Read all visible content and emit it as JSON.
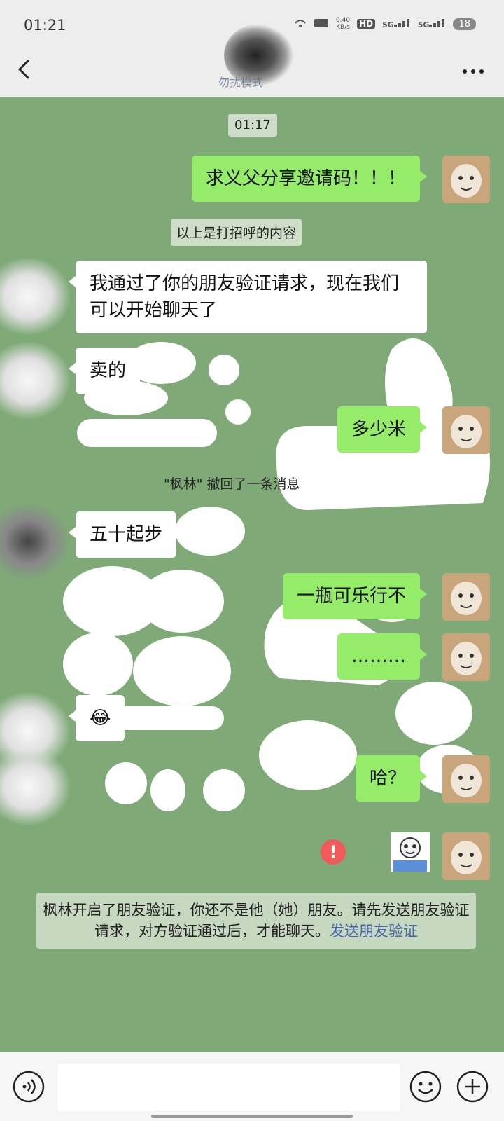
{
  "status_bar": {
    "time": "01:21",
    "net_speed": "0.40\nKB/s",
    "hd": "HD",
    "signal1": "5G",
    "signal2": "5G",
    "battery": "18"
  },
  "header": {
    "title": "勿扰模式",
    "icons": [
      "back-chevron-icon",
      "more-dots-icon"
    ]
  },
  "chat": {
    "timestamp": "01:17",
    "messages": [
      {
        "side": "me",
        "text": "求义父分享邀请码！！！"
      },
      {
        "side": "system",
        "text": "以上是打招呼的内容"
      },
      {
        "side": "them",
        "text": "我通过了你的朋友验证请求，现在我们可以开始聊天了"
      },
      {
        "side": "them",
        "text": "卖的"
      },
      {
        "side": "me",
        "text": "多少米"
      },
      {
        "side": "system",
        "text": "\"枫林\" 撤回了一条消息"
      },
      {
        "side": "them",
        "text": "五十起步"
      },
      {
        "side": "me",
        "text": "一瓶可乐行不"
      },
      {
        "side": "me",
        "text": "………"
      },
      {
        "side": "them",
        "text": "😂"
      },
      {
        "side": "me",
        "text": "哈？"
      },
      {
        "side": "me",
        "sticker": "panda-meme-sticker",
        "failed": true
      }
    ],
    "notice": {
      "text": "枫林开启了朋友验证，你还不是他（她）朋友。请先发送朋友验证请求，对方验证通过后，才能聊天。",
      "link": "发送朋友验证"
    }
  },
  "input_bar": {
    "placeholder": "",
    "icons": [
      "voice-icon",
      "emoji-icon",
      "add-icon"
    ]
  },
  "colors": {
    "chat_bg": "#7faa78",
    "my_bubble": "#95ec69",
    "their_bubble": "#ffffff",
    "link": "#4a66a8",
    "error": "#f05a5a"
  }
}
